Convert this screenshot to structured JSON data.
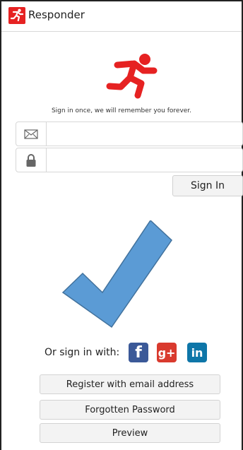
{
  "app": {
    "title": "Responder"
  },
  "signin": {
    "tagline": "Sign in once, we will remember you forever.",
    "email_placeholder": "",
    "password_placeholder": "",
    "button_label": "Sign In"
  },
  "social": {
    "label": "Or sign in with:",
    "providers": [
      "f",
      "g+",
      "in"
    ]
  },
  "actions": {
    "register_label": "Register with email address",
    "forgot_label": "Forgotten Password",
    "preview_label": "Preview"
  },
  "colors": {
    "brand": "#e62222",
    "check": "#5b9bd5",
    "facebook": "#3b5998",
    "google": "#d93a2e",
    "linkedin": "#0e76a8"
  }
}
